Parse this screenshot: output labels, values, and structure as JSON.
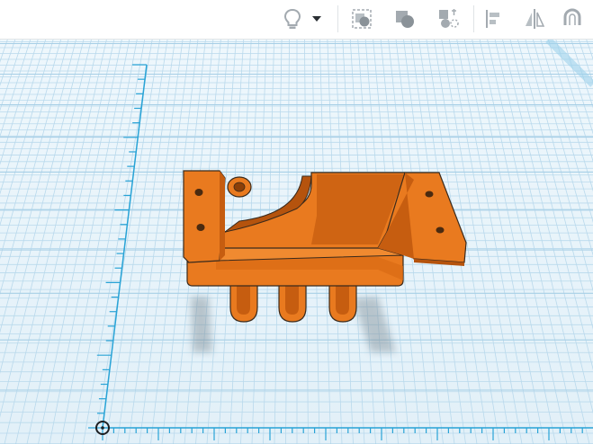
{
  "toolbar": {
    "tools": [
      {
        "name": "note-tool",
        "icon": "lightbulb-icon"
      },
      {
        "name": "note-dropdown",
        "icon": "chevron-down-icon"
      },
      {
        "name": "group-tool",
        "icon": "group-icon"
      },
      {
        "name": "hole-tool",
        "icon": "shape-hole-icon"
      },
      {
        "name": "ungroup-tool",
        "icon": "ungroup-icon"
      },
      {
        "name": "align-tool",
        "icon": "align-icon"
      },
      {
        "name": "mirror-tool",
        "icon": "mirror-icon"
      },
      {
        "name": "magnet-tool",
        "icon": "magnet-icon"
      }
    ]
  },
  "workplane": {
    "grid_color": "#b9d9ec",
    "background": "#e6f3fa",
    "axis_color": "#28a3d6"
  },
  "model": {
    "color": "#e97a1f",
    "shade": "#c65d10",
    "edge": "#3a2a1c"
  }
}
